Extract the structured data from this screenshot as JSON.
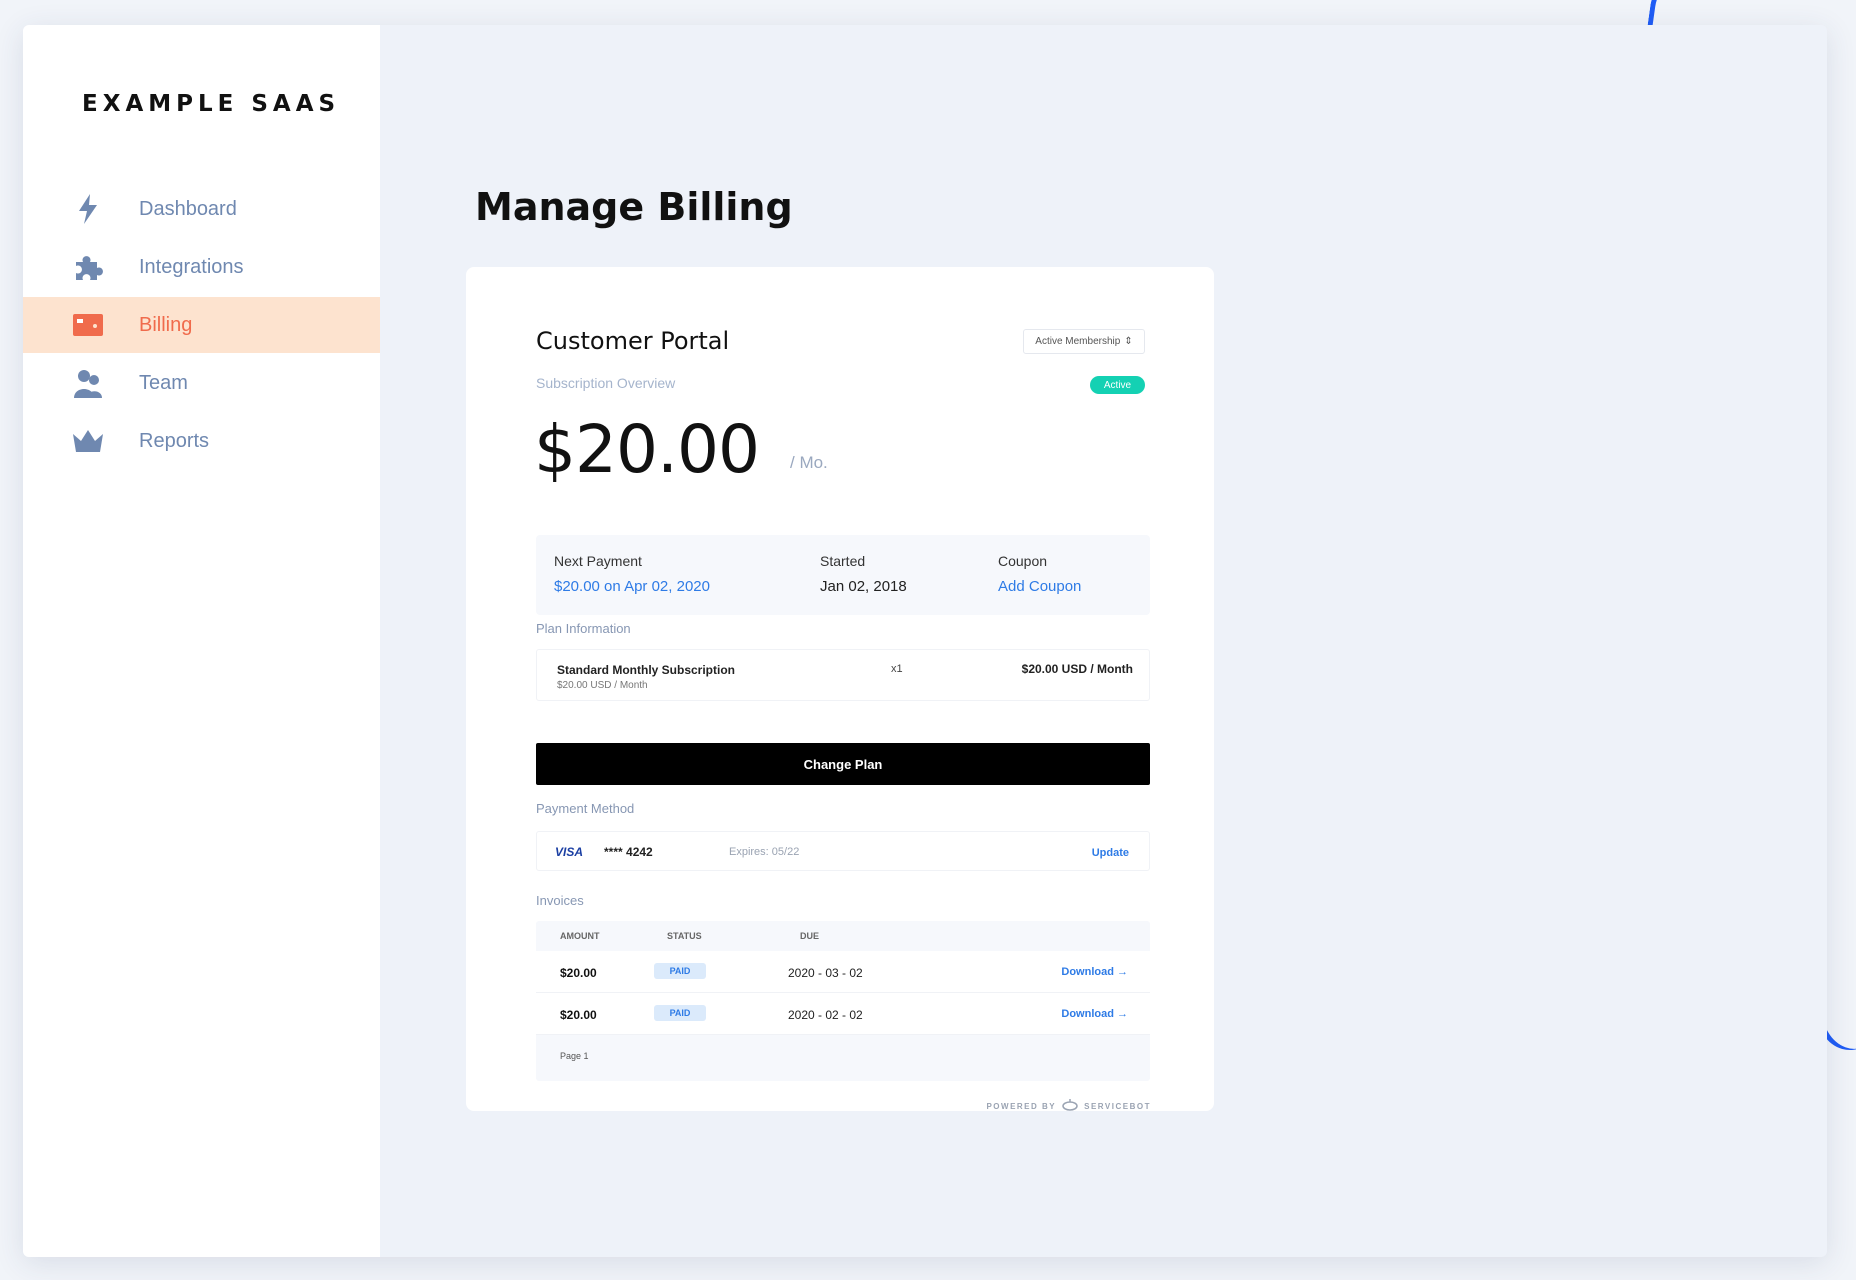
{
  "brand": "EXAMPLE SAAS",
  "nav": [
    {
      "label": "Dashboard",
      "icon": "lightning-icon"
    },
    {
      "label": "Integrations",
      "icon": "puzzle-icon"
    },
    {
      "label": "Billing",
      "icon": "credit-card-icon"
    },
    {
      "label": "Team",
      "icon": "team-icon"
    },
    {
      "label": "Reports",
      "icon": "crown-icon"
    }
  ],
  "page_title": "Manage Billing",
  "portal": {
    "title": "Customer Portal",
    "membership_select": "Active Membership",
    "subscription_overview": "Subscription Overview",
    "status_badge": "Active",
    "price": "$20.00",
    "per": "/ Mo.",
    "summary": {
      "next_payment_label": "Next Payment",
      "next_payment_value": "$20.00 on Apr 02, 2020",
      "started_label": "Started",
      "started_value": "Jan 02, 2018",
      "coupon_label": "Coupon",
      "coupon_value": "Add Coupon"
    },
    "plan_section": "Plan Information",
    "plan": {
      "name": "Standard Monthly Subscription",
      "sub": "$20.00 USD / Month",
      "qty": "x1",
      "price": "$20.00 USD / Month"
    },
    "change_plan": "Change Plan",
    "payment_section": "Payment Method",
    "payment": {
      "brand": "VISA",
      "number": "**** 4242",
      "expires": "Expires: 05/22",
      "update": "Update"
    },
    "invoices_section": "Invoices",
    "invoices": {
      "headers": {
        "amount": "AMOUNT",
        "status": "STATUS",
        "due": "DUE"
      },
      "rows": [
        {
          "amount": "$20.00",
          "status": "PAID",
          "due": "2020 - 03 - 02",
          "action": "Download →"
        },
        {
          "amount": "$20.00",
          "status": "PAID",
          "due": "2020 - 02 - 02",
          "action": "Download →"
        }
      ],
      "page": "Page 1"
    },
    "powered_by": "POWERED BY",
    "powered_brand": "SERVICEBOT"
  },
  "colors": {
    "accent": "#2e7be6",
    "active_nav_bg": "#fde3cf",
    "active_nav_text": "#f06b4c",
    "nav_text": "#6f88b0",
    "status_green": "#14d1b3"
  }
}
